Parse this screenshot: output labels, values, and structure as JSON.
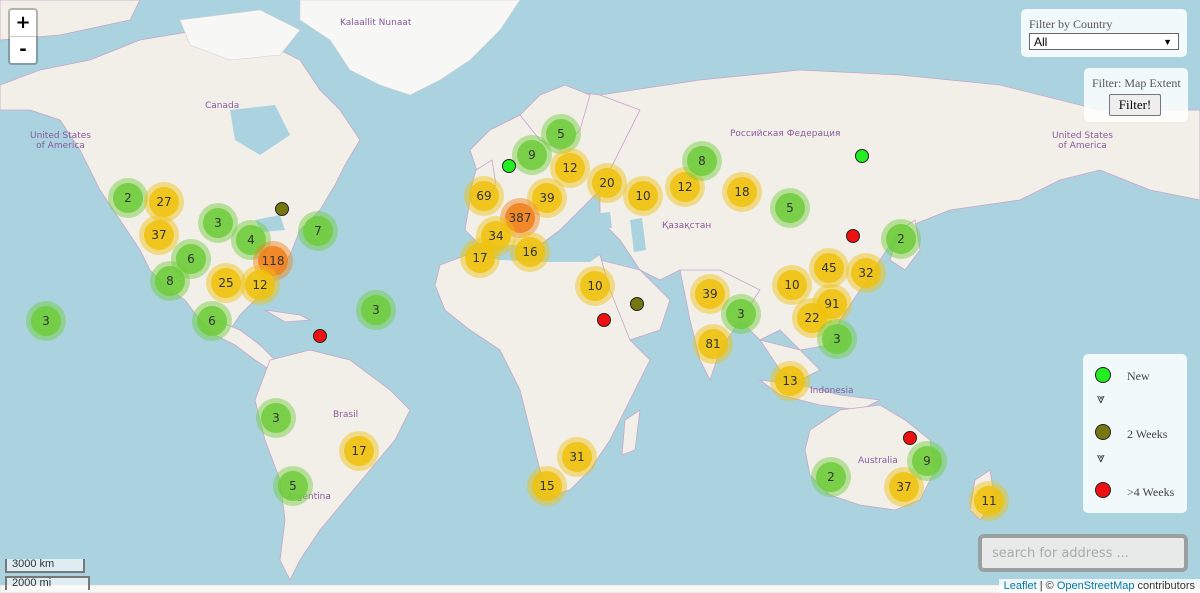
{
  "zoom": {
    "in_label": "+",
    "out_label": "-"
  },
  "country_filter": {
    "title": "Filter by Country",
    "selected": "All"
  },
  "extent_filter": {
    "title": "Filter: Map Extent",
    "button_label": "Filter!"
  },
  "legend": {
    "items": [
      {
        "label": "New",
        "color": "#22ee22"
      },
      {
        "label": "2 Weeks",
        "color": "#777711"
      },
      {
        "label": ">4 Weeks",
        "color": "#ee1111"
      }
    ],
    "arrow_glyph": "⩔"
  },
  "search": {
    "placeholder": "search for address ..."
  },
  "scale": {
    "metric": "3000 km",
    "imperial": "2000 mi"
  },
  "attribution": {
    "leaflet": "Leaflet",
    "separator": " | © ",
    "osm": "OpenStreetMap",
    "suffix": " contributors"
  },
  "map_labels": [
    {
      "text": "Kalaallit Nunaat"
    },
    {
      "text": "Canada"
    },
    {
      "text": "United States\nof America"
    },
    {
      "text": "United States\nof America"
    },
    {
      "text": "Российская Федерация"
    },
    {
      "text": "Қазақстан"
    },
    {
      "text": "Brasil"
    },
    {
      "text": "Argentina"
    },
    {
      "text": "Indonesia"
    },
    {
      "text": "Australia"
    }
  ],
  "clusters": [
    2,
    27,
    37,
    3,
    4,
    7,
    6,
    118,
    8,
    25,
    12,
    6,
    3,
    3,
    3,
    5,
    17,
    5,
    9,
    12,
    69,
    39,
    387,
    34,
    17,
    16,
    20,
    10,
    12,
    8,
    18,
    5,
    2,
    10,
    39,
    3,
    81,
    10,
    45,
    32,
    91,
    22,
    3,
    13,
    31,
    15,
    2,
    37,
    9,
    11
  ],
  "markers": [
    "new",
    "new",
    "2weeks",
    "old",
    "2weeks",
    "old",
    "old",
    "old"
  ]
}
